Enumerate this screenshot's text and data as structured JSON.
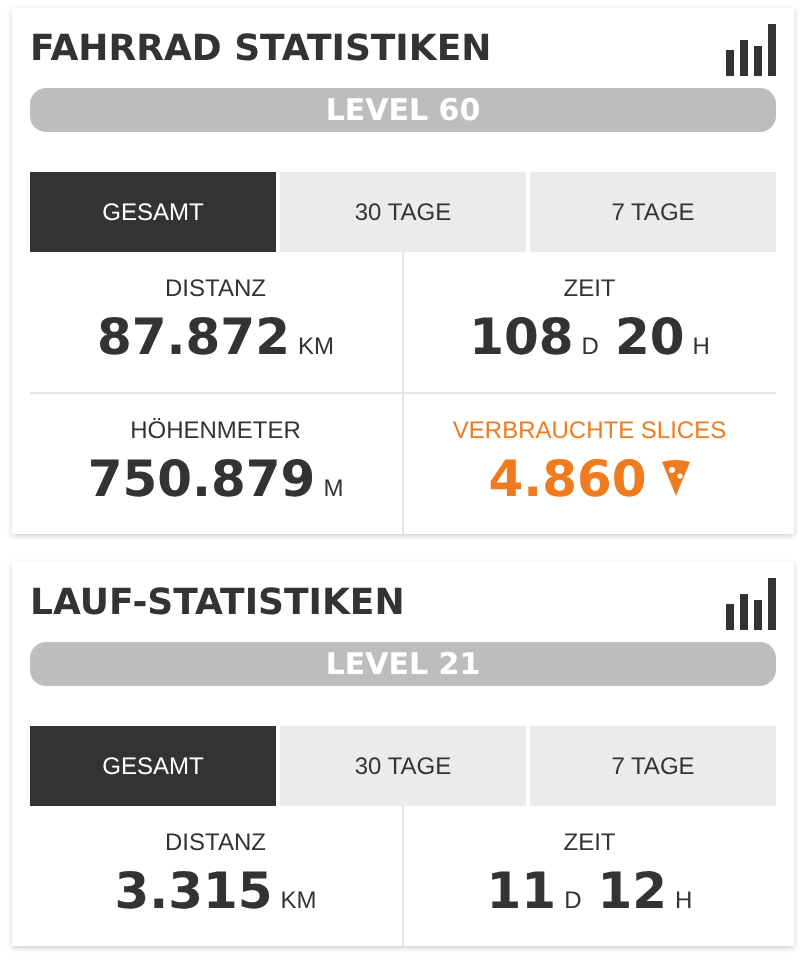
{
  "cards": [
    {
      "title": "FAHRRAD STATISTIKEN",
      "level_label": "LEVEL 60",
      "tabs": [
        {
          "label": "GESAMT",
          "selected": true
        },
        {
          "label": "30 TAGE",
          "selected": false
        },
        {
          "label": "7 TAGE",
          "selected": false
        }
      ],
      "stats": [
        {
          "kind": "plain",
          "label": "DISTANZ",
          "parts": [
            {
              "number": "87.872",
              "unit": "KM"
            }
          ]
        },
        {
          "kind": "plain",
          "label": "ZEIT",
          "parts": [
            {
              "number": "108",
              "unit": "D"
            },
            {
              "number": "20",
              "unit": "H"
            }
          ]
        },
        {
          "kind": "plain",
          "label": "HÖHENMETER",
          "parts": [
            {
              "number": "750.879",
              "unit": "M"
            }
          ]
        },
        {
          "kind": "slices",
          "label": "VERBRAUCHTE SLICES",
          "parts": [
            {
              "number": "4.860"
            }
          ]
        }
      ]
    },
    {
      "title": "LAUF-STATISTIKEN",
      "level_label": "LEVEL 21",
      "tabs": [
        {
          "label": "GESAMT",
          "selected": true
        },
        {
          "label": "30 TAGE",
          "selected": false
        },
        {
          "label": "7 TAGE",
          "selected": false
        }
      ],
      "stats": [
        {
          "kind": "plain",
          "label": "DISTANZ",
          "parts": [
            {
              "number": "3.315",
              "unit": "KM"
            }
          ]
        },
        {
          "kind": "plain",
          "label": "ZEIT",
          "parts": [
            {
              "number": "11",
              "unit": "D"
            },
            {
              "number": "12",
              "unit": "H"
            }
          ]
        }
      ]
    }
  ]
}
